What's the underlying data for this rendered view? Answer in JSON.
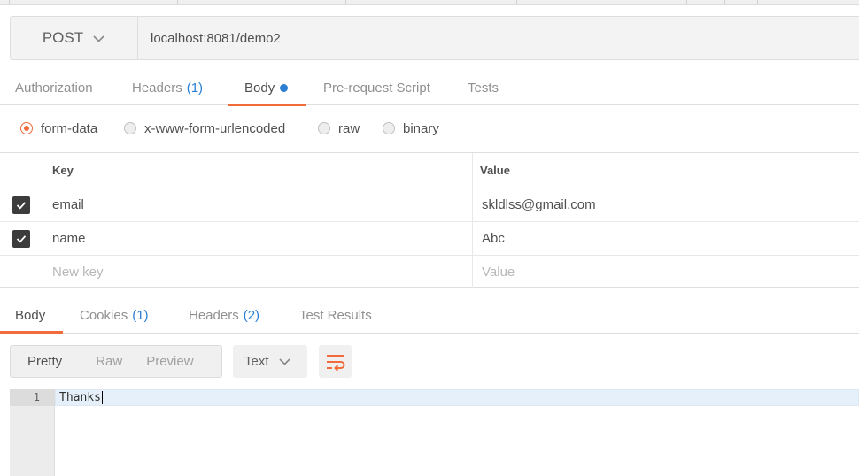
{
  "request": {
    "method": "POST",
    "url": "localhost:8081/demo2"
  },
  "request_tabs": {
    "authorization": "Authorization",
    "headers": "Headers",
    "headers_count": "(1)",
    "body": "Body",
    "prerequest": "Pre-request Script",
    "tests": "Tests"
  },
  "body_types": {
    "form_data": "form-data",
    "urlencoded": "x-www-form-urlencoded",
    "raw": "raw",
    "binary": "binary",
    "selected": "form-data"
  },
  "params": {
    "key_header": "Key",
    "value_header": "Value",
    "rows": [
      {
        "key": "email",
        "value": "skldlss@gmail.com",
        "checked": true
      },
      {
        "key": "name",
        "value": "Abc",
        "checked": true
      }
    ],
    "new_key_placeholder": "New key",
    "new_value_placeholder": "Value"
  },
  "response_tabs": {
    "body": "Body",
    "cookies": "Cookies",
    "cookies_count": "(1)",
    "headers": "Headers",
    "headers_count": "(2)",
    "test_results": "Test Results"
  },
  "response_toolbar": {
    "pretty": "Pretty",
    "raw": "Raw",
    "preview": "Preview",
    "format": "Text"
  },
  "response_body": {
    "line_number": "1",
    "content": "Thanks"
  },
  "colors": {
    "accent": "#f26b3a",
    "link": "#2a7fd4"
  }
}
